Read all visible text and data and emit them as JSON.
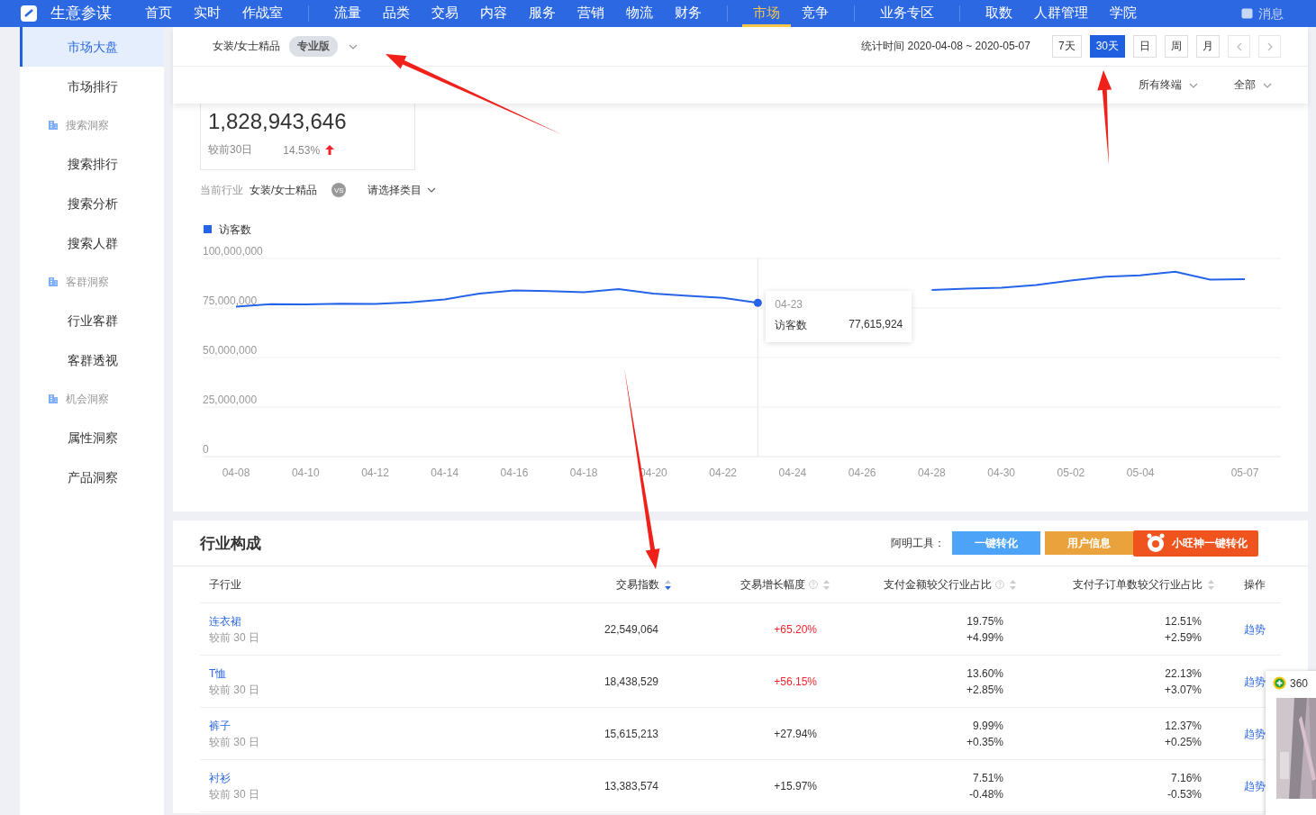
{
  "top_nav": {
    "logo": "生意参谋",
    "groups": [
      [
        {
          "label": "首页",
          "selected": false
        },
        {
          "label": "实时",
          "selected": false
        },
        {
          "label": "作战室",
          "selected": false
        }
      ],
      [
        {
          "label": "流量",
          "selected": false
        },
        {
          "label": "品类",
          "selected": false
        },
        {
          "label": "交易",
          "selected": false
        },
        {
          "label": "内容",
          "selected": false
        },
        {
          "label": "服务",
          "selected": false
        },
        {
          "label": "营销",
          "selected": false
        },
        {
          "label": "物流",
          "selected": false
        },
        {
          "label": "财务",
          "selected": false
        }
      ],
      [
        {
          "label": "市场",
          "selected": true
        },
        {
          "label": "竞争",
          "selected": false
        }
      ],
      [
        {
          "label": "业务专区",
          "selected": false
        }
      ],
      [
        {
          "label": "取数",
          "selected": false
        },
        {
          "label": "人群管理",
          "selected": false
        },
        {
          "label": "学院",
          "selected": false
        }
      ]
    ],
    "message": "消息"
  },
  "sidebar": {
    "items": [
      {
        "kind": "link",
        "label": "市场大盘",
        "selected": true
      },
      {
        "kind": "link",
        "label": "市场排行",
        "selected": false
      },
      {
        "kind": "group",
        "label": "搜索洞察"
      },
      {
        "kind": "link",
        "label": "搜索排行",
        "selected": false
      },
      {
        "kind": "link",
        "label": "搜索分析",
        "selected": false
      },
      {
        "kind": "link",
        "label": "搜索人群",
        "selected": false
      },
      {
        "kind": "group",
        "label": "客群洞察"
      },
      {
        "kind": "link",
        "label": "行业客群",
        "selected": false
      },
      {
        "kind": "link",
        "label": "客群透视",
        "selected": false
      },
      {
        "kind": "group",
        "label": "机会洞察"
      },
      {
        "kind": "link",
        "label": "属性洞察",
        "selected": false
      },
      {
        "kind": "link",
        "label": "产品洞察",
        "selected": false
      }
    ]
  },
  "header": {
    "industry": "女装/女士精品",
    "edition": "专业版",
    "stat_time": "统计时间 2020-04-08 ~ 2020-05-07",
    "periods": [
      {
        "label": "7天",
        "selected": false
      },
      {
        "label": "30天",
        "selected": true
      },
      {
        "label": "日",
        "selected": false
      },
      {
        "label": "周",
        "selected": false
      },
      {
        "label": "月",
        "selected": false
      }
    ],
    "filters": [
      {
        "label": "所有终端"
      },
      {
        "label": "全部"
      }
    ]
  },
  "kpi_card": {
    "value": "1,828,943,646",
    "compare_label": "较前30日",
    "change": "14.53%",
    "up": true
  },
  "compare_bar": {
    "label": "当前行业",
    "industry": "女装/女士精品",
    "vs": "VS",
    "category_placeholder": "请选择类目"
  },
  "chart_data": {
    "type": "line",
    "grid": true,
    "categories": [
      "04-08",
      null,
      "04-10",
      null,
      "04-12",
      null,
      "04-14",
      null,
      "04-16",
      null,
      "04-18",
      null,
      "04-20",
      null,
      "04-22",
      null,
      "04-24",
      null,
      "04-26",
      null,
      "04-28",
      null,
      "04-30",
      null,
      "05-02",
      null,
      "05-04",
      null,
      null,
      "05-07"
    ],
    "series": [
      {
        "name": "访客数",
        "color": "#2563e8",
        "values": [
          75700000,
          76900000,
          76800000,
          77200000,
          77100000,
          77800000,
          79300000,
          82300000,
          83800000,
          83500000,
          83000000,
          84500000,
          82300000,
          81200000,
          80100000,
          77600000,
          null,
          null,
          null,
          null,
          84100000,
          84800000,
          85200000,
          86600000,
          88900000,
          90800000,
          91500000,
          93300000,
          89300000,
          89600000
        ]
      }
    ],
    "ylim": [
      0,
      100000000
    ],
    "yticks": [
      {
        "value": 0,
        "label": "0"
      },
      {
        "value": 25000000,
        "label": "25,000,000"
      },
      {
        "value": 50000000,
        "label": "50,000,000"
      },
      {
        "value": 75000000,
        "label": "75,000,000"
      },
      {
        "value": 100000000,
        "label": "100,000,000"
      }
    ],
    "annotations": [
      {
        "text": "04-23"
      }
    ]
  },
  "tooltip": {
    "series": "访客数",
    "value": "77,615,924"
  },
  "industry_table": {
    "title": "行业构成",
    "tools_label": "阿明工具：",
    "tool_buttons": [
      {
        "kind": "plain",
        "label": "一键转化"
      },
      {
        "kind": "accent",
        "label": "用户信息"
      },
      {
        "kind": "logo",
        "label": "小旺神一键转化"
      }
    ],
    "columns": [
      {
        "label": "子行业",
        "sortable": false,
        "sorted": false,
        "help": false
      },
      {
        "label": "交易指数",
        "sortable": true,
        "sorted": true,
        "help": false
      },
      {
        "label": "交易增长幅度",
        "sortable": true,
        "sorted": false,
        "help": true
      },
      {
        "label": "支付金额较父行业占比",
        "sortable": true,
        "sorted": false,
        "help": true
      },
      {
        "label": "支付子订单数较父行业占比",
        "sortable": true,
        "sorted": false,
        "help": false
      },
      {
        "label": "操作",
        "sortable": false,
        "sorted": false,
        "help": false
      }
    ],
    "rows": [
      {
        "name": "连衣裙",
        "compare": "较前 30 日",
        "index": "22,549,064",
        "growth": "+65.20%",
        "growth_highlight": true,
        "pay_share": "19.75%",
        "pay_share_change": "+4.99%",
        "order_share": "12.51%",
        "order_share_change": "+2.59%",
        "action": "趋势"
      },
      {
        "name": "T恤",
        "compare": "较前 30 日",
        "index": "18,438,529",
        "growth": "+56.15%",
        "growth_highlight": true,
        "pay_share": "13.60%",
        "pay_share_change": "+2.85%",
        "order_share": "22.13%",
        "order_share_change": "+3.07%",
        "action": "趋势"
      },
      {
        "name": "裤子",
        "compare": "较前 30 日",
        "index": "15,615,213",
        "growth": "+27.94%",
        "growth_highlight": false,
        "pay_share": "9.99%",
        "pay_share_change": "+0.35%",
        "order_share": "12.37%",
        "order_share_change": "+0.25%",
        "action": "趋势"
      },
      {
        "name": "衬衫",
        "compare": "较前 30 日",
        "index": "13,383,574",
        "growth": "+15.97%",
        "growth_highlight": false,
        "pay_share": "7.51%",
        "pay_share_change": "-0.48%",
        "order_share": "7.16%",
        "order_share_change": "-0.53%",
        "action": "趋势"
      }
    ]
  },
  "popup": {
    "text": "360"
  }
}
